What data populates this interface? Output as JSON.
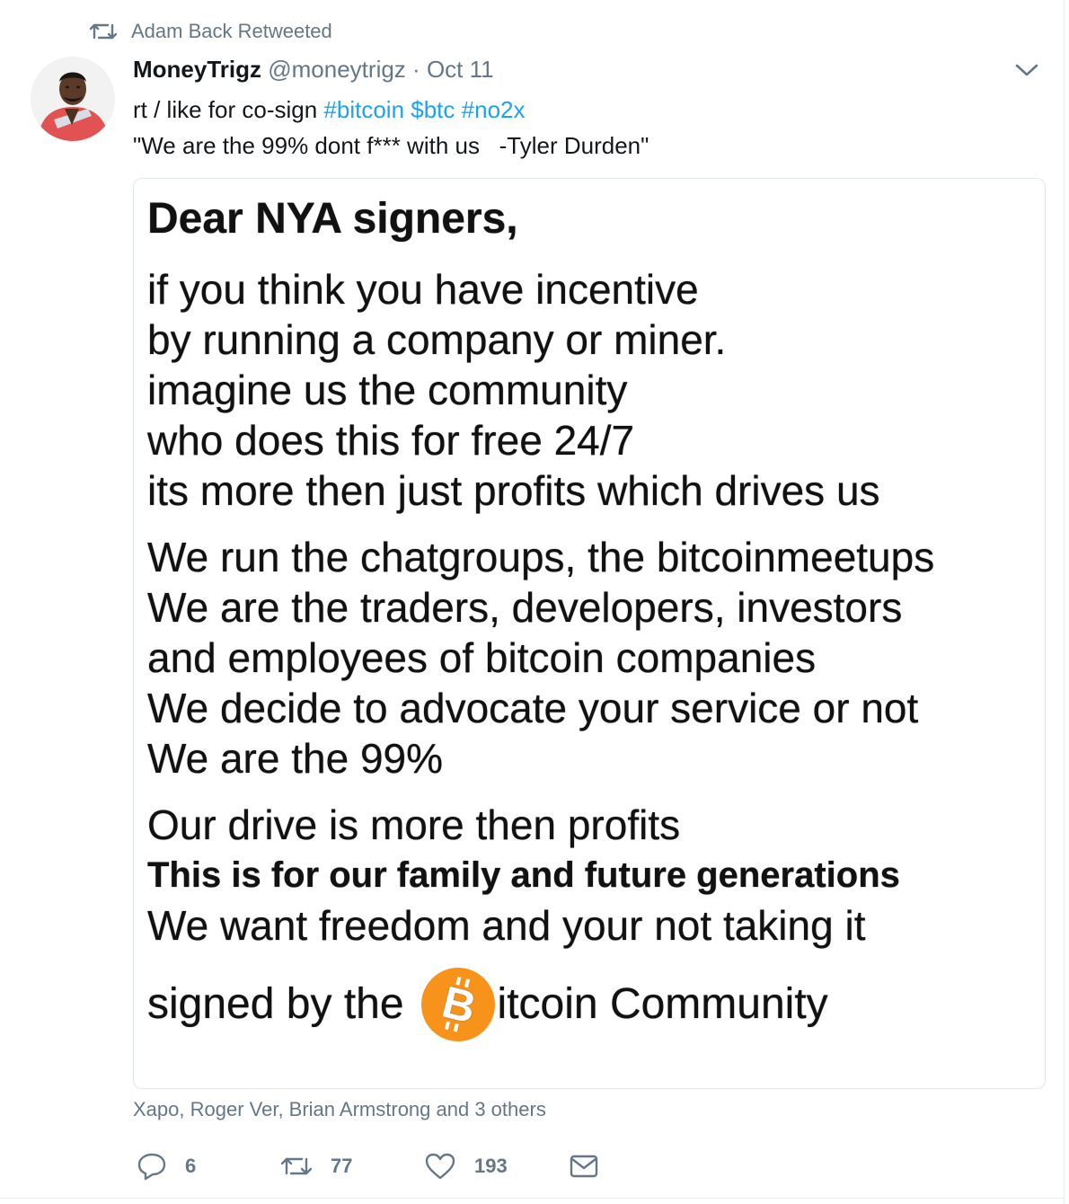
{
  "retweet_context": {
    "icon": "retweet-icon",
    "label": "Adam Back Retweeted"
  },
  "author": {
    "name": "MoneyTrigz",
    "handle": "@moneytrigz",
    "separator": "·",
    "date": "Oct 11"
  },
  "tweet_text": {
    "line1_prefix": "rt / like for co-sign ",
    "hashtag1": "#bitcoin",
    "cashtag": "$btc",
    "hashtag2": "#no2x",
    "line2": "\"We are the 99% dont f*** with us   -Tyler Durden\""
  },
  "media": {
    "title": "Dear NYA signers,",
    "para1": [
      "if you think you have incentive",
      "by running a company or miner.",
      "imagine us the community",
      "who does this for free 24/7",
      "its more then just profits which drives us"
    ],
    "para2": [
      "We run the chatgroups, the bitcoinmeetups",
      "We are the traders, developers, investors",
      "and employees of bitcoin companies",
      "We decide to advocate your service or not",
      "We are the 99%"
    ],
    "para3_line1": "Our drive is more then profits",
    "para3_line2": "This is for our family and future generations",
    "para3_line3": "We want freedom and your not taking it",
    "sign_prefix": "signed by the",
    "sign_suffix": "itcoin Community",
    "logo_letter": "B",
    "logo_color": "#f7931a"
  },
  "likers": "Xapo, Roger Ver, Brian Armstrong and 3 others",
  "actions": {
    "reply_count": "6",
    "retweet_count": "77",
    "like_count": "193"
  },
  "colors": {
    "link": "#1da1f2",
    "secondary_text": "#657786",
    "border": "#e1e8ed"
  }
}
